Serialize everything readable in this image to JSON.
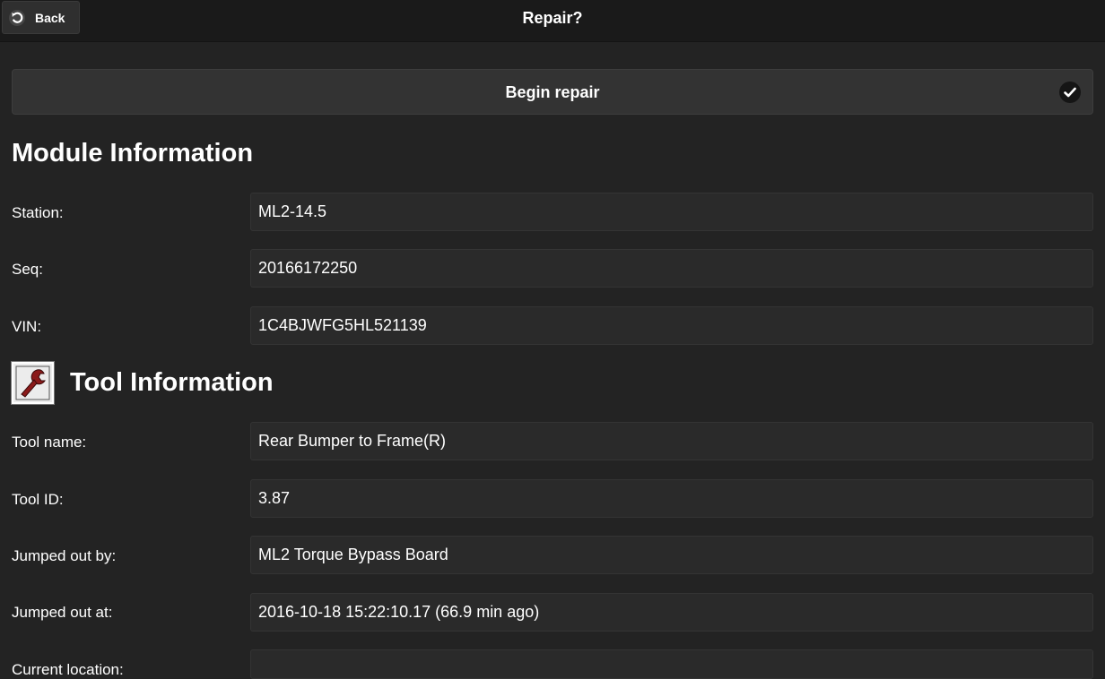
{
  "header": {
    "back_label": "Back",
    "title": "Repair?"
  },
  "begin_repair": {
    "label": "Begin repair"
  },
  "module_info": {
    "title": "Module Information",
    "rows": [
      {
        "label": "Station:",
        "value": "ML2-14.5"
      },
      {
        "label": "Seq:",
        "value": "20166172250"
      },
      {
        "label": "VIN:",
        "value": "1C4BJWFG5HL521139"
      }
    ]
  },
  "tool_info": {
    "title": "Tool Information",
    "icon": "wrench-icon",
    "rows": [
      {
        "label": "Tool name:",
        "value": "Rear Bumper to Frame(R)"
      },
      {
        "label": "Tool ID:",
        "value": "3.87"
      },
      {
        "label": "Jumped out by:",
        "value": "ML2 Torque Bypass Board"
      },
      {
        "label": "Jumped out at:",
        "value": "2016-10-18 15:22:10.17 (66.9 min ago)"
      },
      {
        "label": "Current location:",
        "value": ""
      }
    ]
  },
  "colors": {
    "background": "#232323",
    "header": "#1a1a1a",
    "field": "#2a2a2a",
    "tool_icon_accent": "#8b1a1a"
  }
}
